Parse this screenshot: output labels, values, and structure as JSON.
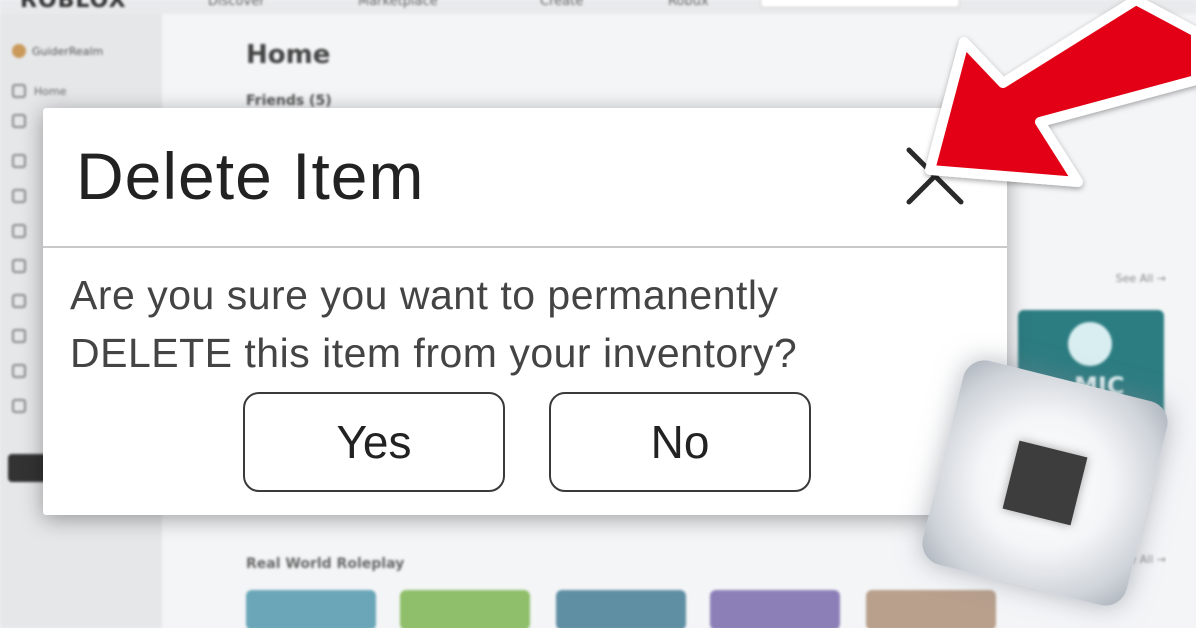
{
  "background": {
    "logo": "ROBLOX",
    "nav": [
      "Discover",
      "Marketplace",
      "Create",
      "Robux"
    ],
    "sidebar": {
      "username": "GuiderRealm",
      "items": [
        {
          "label": "Home"
        }
      ]
    },
    "main": {
      "title": "Home",
      "friends_label": "Friends (5)",
      "see_all": "See All →",
      "tile_text": "MIC",
      "section2": "Real World Roleplay"
    }
  },
  "dialog": {
    "title": "Delete Item",
    "message_line1": "Are you sure you want to permanently",
    "message_line2": "DELETE this item from your inventory?",
    "yes_label": "Yes",
    "no_label": "No",
    "close_icon": "close-x"
  },
  "overlays": {
    "arrow_color": "#e30613",
    "arrow_icon": "red-arrow-pointing-to-close",
    "logo_icon": "roblox-logo"
  },
  "colors": {
    "dialog_bg": "#ffffff",
    "button_border": "#3a3a3a",
    "arrow": "#e30613"
  }
}
